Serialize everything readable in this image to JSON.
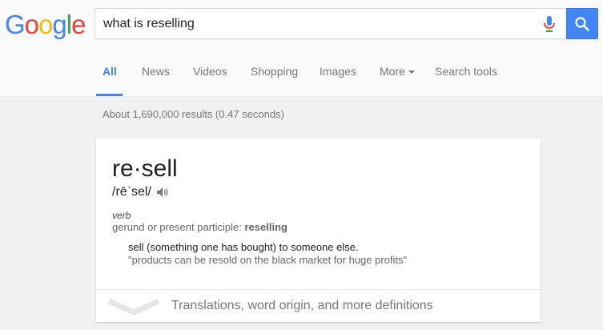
{
  "logo": {
    "letters": [
      {
        "ch": "G",
        "color": "#4285f4"
      },
      {
        "ch": "o",
        "color": "#ea4335"
      },
      {
        "ch": "o",
        "color": "#fbbc05"
      },
      {
        "ch": "g",
        "color": "#4285f4"
      },
      {
        "ch": "l",
        "color": "#34a853"
      },
      {
        "ch": "e",
        "color": "#ea4335"
      }
    ]
  },
  "search": {
    "value": "what is reselling",
    "mic_icon": "microphone-icon",
    "button_icon": "search-icon",
    "button_color": "#4285f4"
  },
  "tabs": [
    {
      "label": "All",
      "active": true
    },
    {
      "label": "News"
    },
    {
      "label": "Videos"
    },
    {
      "label": "Shopping"
    },
    {
      "label": "Images"
    },
    {
      "label": "More"
    },
    {
      "label": "Search tools"
    }
  ],
  "results_stats": "About 1,690,000 results (0.47 seconds)",
  "definition": {
    "headword": "re·sell",
    "pronunciation": "/rēˈsel/",
    "speaker_icon": "speaker-icon",
    "part_of_speech": "verb",
    "participle_prefix": "gerund or present participle: ",
    "participle_word": "reselling",
    "meaning": "sell (something one has bought) to someone else.",
    "example": "\"products can be resold on the black market for huge profits\"",
    "footer_link": "Translations, word origin, and more definitions",
    "footer_icon": "chevron-down-icon"
  }
}
